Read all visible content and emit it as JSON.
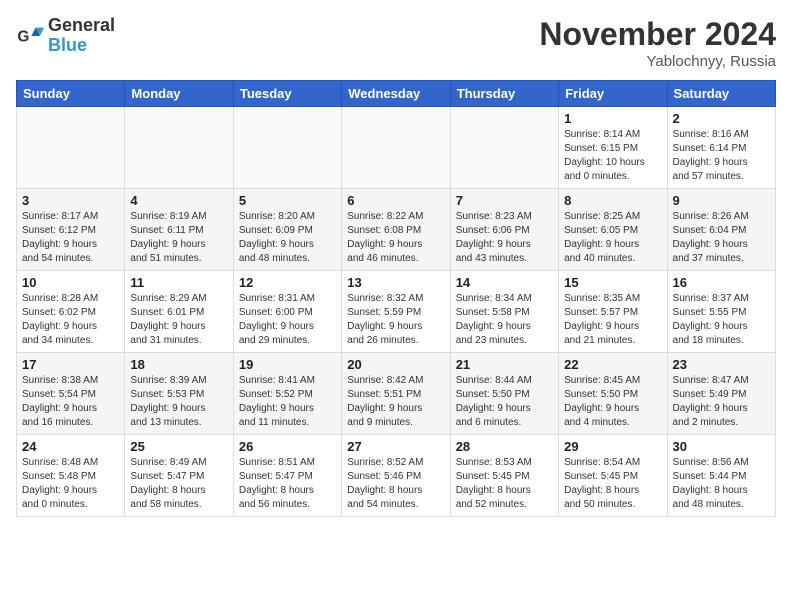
{
  "header": {
    "logo_line1": "General",
    "logo_line2": "Blue",
    "month": "November 2024",
    "location": "Yablochnyy, Russia"
  },
  "weekdays": [
    "Sunday",
    "Monday",
    "Tuesday",
    "Wednesday",
    "Thursday",
    "Friday",
    "Saturday"
  ],
  "weeks": [
    [
      {
        "day": "",
        "info": ""
      },
      {
        "day": "",
        "info": ""
      },
      {
        "day": "",
        "info": ""
      },
      {
        "day": "",
        "info": ""
      },
      {
        "day": "",
        "info": ""
      },
      {
        "day": "1",
        "info": "Sunrise: 8:14 AM\nSunset: 6:15 PM\nDaylight: 10 hours\nand 0 minutes."
      },
      {
        "day": "2",
        "info": "Sunrise: 8:16 AM\nSunset: 6:14 PM\nDaylight: 9 hours\nand 57 minutes."
      }
    ],
    [
      {
        "day": "3",
        "info": "Sunrise: 8:17 AM\nSunset: 6:12 PM\nDaylight: 9 hours\nand 54 minutes."
      },
      {
        "day": "4",
        "info": "Sunrise: 8:19 AM\nSunset: 6:11 PM\nDaylight: 9 hours\nand 51 minutes."
      },
      {
        "day": "5",
        "info": "Sunrise: 8:20 AM\nSunset: 6:09 PM\nDaylight: 9 hours\nand 48 minutes."
      },
      {
        "day": "6",
        "info": "Sunrise: 8:22 AM\nSunset: 6:08 PM\nDaylight: 9 hours\nand 46 minutes."
      },
      {
        "day": "7",
        "info": "Sunrise: 8:23 AM\nSunset: 6:06 PM\nDaylight: 9 hours\nand 43 minutes."
      },
      {
        "day": "8",
        "info": "Sunrise: 8:25 AM\nSunset: 6:05 PM\nDaylight: 9 hours\nand 40 minutes."
      },
      {
        "day": "9",
        "info": "Sunrise: 8:26 AM\nSunset: 6:04 PM\nDaylight: 9 hours\nand 37 minutes."
      }
    ],
    [
      {
        "day": "10",
        "info": "Sunrise: 8:28 AM\nSunset: 6:02 PM\nDaylight: 9 hours\nand 34 minutes."
      },
      {
        "day": "11",
        "info": "Sunrise: 8:29 AM\nSunset: 6:01 PM\nDaylight: 9 hours\nand 31 minutes."
      },
      {
        "day": "12",
        "info": "Sunrise: 8:31 AM\nSunset: 6:00 PM\nDaylight: 9 hours\nand 29 minutes."
      },
      {
        "day": "13",
        "info": "Sunrise: 8:32 AM\nSunset: 5:59 PM\nDaylight: 9 hours\nand 26 minutes."
      },
      {
        "day": "14",
        "info": "Sunrise: 8:34 AM\nSunset: 5:58 PM\nDaylight: 9 hours\nand 23 minutes."
      },
      {
        "day": "15",
        "info": "Sunrise: 8:35 AM\nSunset: 5:57 PM\nDaylight: 9 hours\nand 21 minutes."
      },
      {
        "day": "16",
        "info": "Sunrise: 8:37 AM\nSunset: 5:55 PM\nDaylight: 9 hours\nand 18 minutes."
      }
    ],
    [
      {
        "day": "17",
        "info": "Sunrise: 8:38 AM\nSunset: 5:54 PM\nDaylight: 9 hours\nand 16 minutes."
      },
      {
        "day": "18",
        "info": "Sunrise: 8:39 AM\nSunset: 5:53 PM\nDaylight: 9 hours\nand 13 minutes."
      },
      {
        "day": "19",
        "info": "Sunrise: 8:41 AM\nSunset: 5:52 PM\nDaylight: 9 hours\nand 11 minutes."
      },
      {
        "day": "20",
        "info": "Sunrise: 8:42 AM\nSunset: 5:51 PM\nDaylight: 9 hours\nand 9 minutes."
      },
      {
        "day": "21",
        "info": "Sunrise: 8:44 AM\nSunset: 5:50 PM\nDaylight: 9 hours\nand 6 minutes."
      },
      {
        "day": "22",
        "info": "Sunrise: 8:45 AM\nSunset: 5:50 PM\nDaylight: 9 hours\nand 4 minutes."
      },
      {
        "day": "23",
        "info": "Sunrise: 8:47 AM\nSunset: 5:49 PM\nDaylight: 9 hours\nand 2 minutes."
      }
    ],
    [
      {
        "day": "24",
        "info": "Sunrise: 8:48 AM\nSunset: 5:48 PM\nDaylight: 9 hours\nand 0 minutes."
      },
      {
        "day": "25",
        "info": "Sunrise: 8:49 AM\nSunset: 5:47 PM\nDaylight: 8 hours\nand 58 minutes."
      },
      {
        "day": "26",
        "info": "Sunrise: 8:51 AM\nSunset: 5:47 PM\nDaylight: 8 hours\nand 56 minutes."
      },
      {
        "day": "27",
        "info": "Sunrise: 8:52 AM\nSunset: 5:46 PM\nDaylight: 8 hours\nand 54 minutes."
      },
      {
        "day": "28",
        "info": "Sunrise: 8:53 AM\nSunset: 5:45 PM\nDaylight: 8 hours\nand 52 minutes."
      },
      {
        "day": "29",
        "info": "Sunrise: 8:54 AM\nSunset: 5:45 PM\nDaylight: 8 hours\nand 50 minutes."
      },
      {
        "day": "30",
        "info": "Sunrise: 8:56 AM\nSunset: 5:44 PM\nDaylight: 8 hours\nand 48 minutes."
      }
    ]
  ]
}
